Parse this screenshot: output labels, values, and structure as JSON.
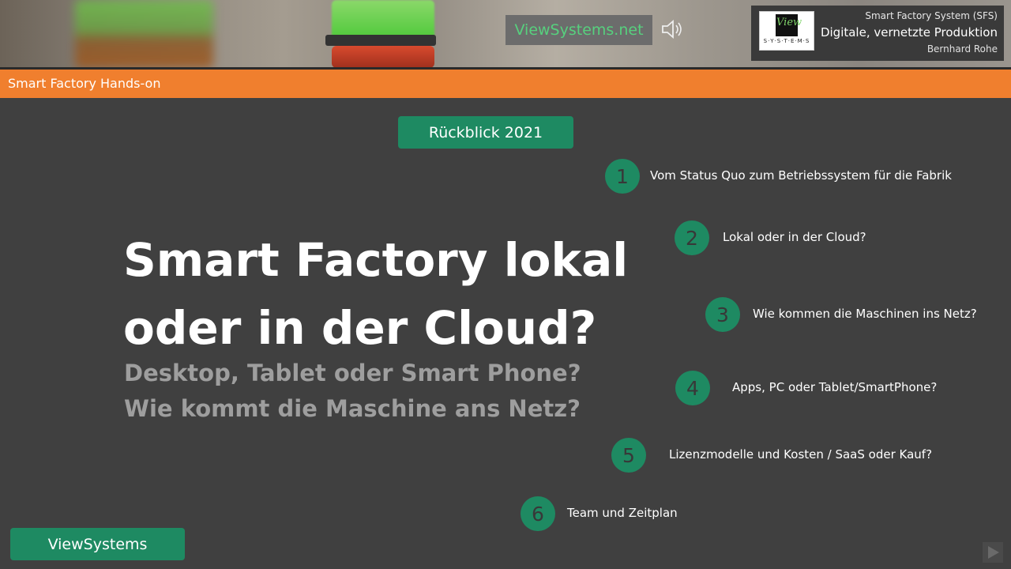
{
  "header": {
    "site_badge": "ViewSystems.net",
    "logo_text": "View",
    "logo_subtext": "S·Y·S·T·E·M·S",
    "info_line1": "Smart Factory System (SFS)",
    "info_line2": "Digitale, vernetzte Produktion",
    "info_line3": "Bernhard Rohe"
  },
  "banner": {
    "label": "Smart Factory Hands-on"
  },
  "review_pill": "Rückblick 2021",
  "main": {
    "title_line1": "Smart Factory lokal",
    "title_line2": "oder in der Cloud?",
    "subtitle_line1": "Desktop, Tablet oder Smart Phone?",
    "subtitle_line2": "Wie kommt die Maschine ans Netz?"
  },
  "agenda": [
    {
      "num": "1",
      "label": "Vom Status Quo zum Betriebssystem für die Fabrik"
    },
    {
      "num": "2",
      "label": "Lokal oder in der Cloud?"
    },
    {
      "num": "3",
      "label": "Wie kommen die Maschinen ins Netz?"
    },
    {
      "num": "4",
      "label": "Apps, PC oder Tablet/SmartPhone?"
    },
    {
      "num": "5",
      "label": "Lizenzmodelle und Kosten / SaaS oder Kauf?"
    },
    {
      "num": "6",
      "label": "Team und Zeitplan"
    }
  ],
  "footer_pill": "ViewSystems",
  "colors": {
    "accent_green": "#1e8a62",
    "banner_orange": "#f07f2e",
    "background": "#404040"
  },
  "icons": {
    "speaker": "speaker-icon",
    "next": "next-arrow-icon"
  }
}
